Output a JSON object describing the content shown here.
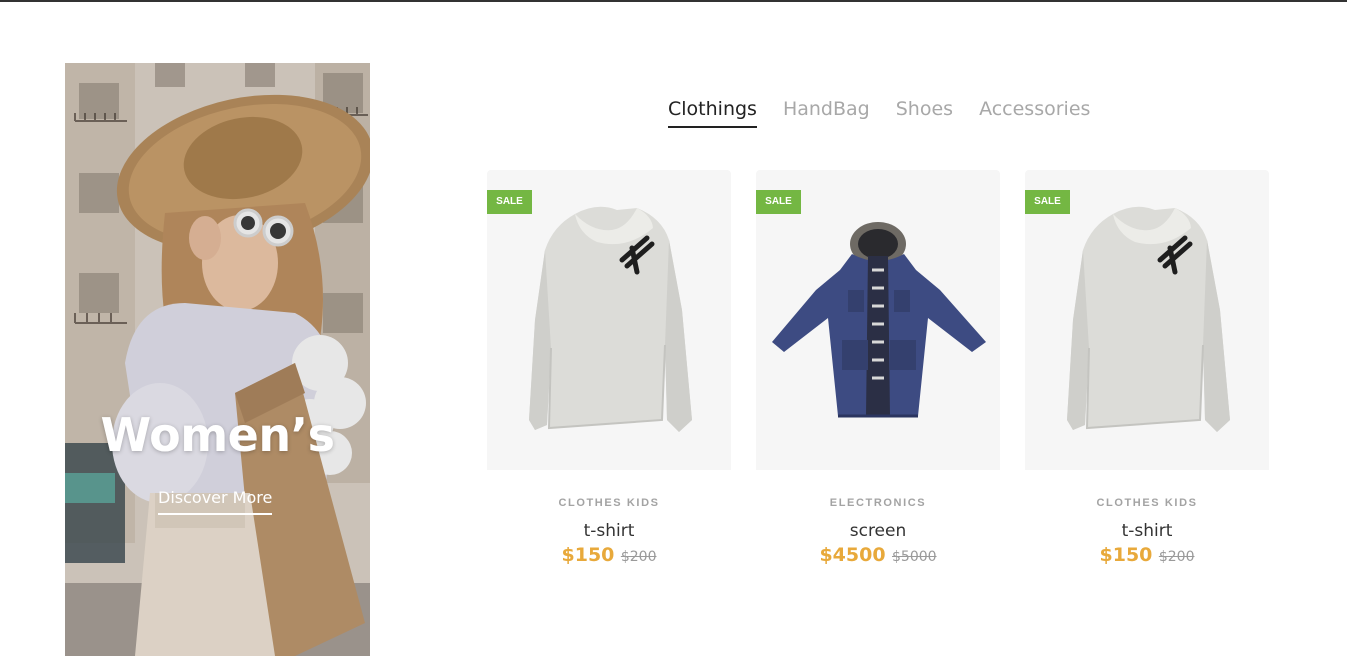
{
  "banner": {
    "title": "Women’s",
    "link_label": "Discover More"
  },
  "tabs": [
    {
      "label": "Clothings",
      "active": true
    },
    {
      "label": "HandBag",
      "active": false
    },
    {
      "label": "Shoes",
      "active": false
    },
    {
      "label": "Accessories",
      "active": false
    }
  ],
  "products": [
    {
      "badge": "SALE",
      "category": "CLOTHES KIDS",
      "name": "t-shirt",
      "price": "$150",
      "old_price": "$200",
      "image": "white-sweater-icon"
    },
    {
      "badge": "SALE",
      "category": "ELECTRONICS",
      "name": "screen",
      "price": "$4500",
      "old_price": "$5000",
      "image": "navy-parka-icon"
    },
    {
      "badge": "SALE",
      "category": "CLOTHES KIDS",
      "name": "t-shirt",
      "price": "$150",
      "old_price": "$200",
      "image": "white-sweater-icon"
    }
  ],
  "colors": {
    "sale_badge": "#74b743",
    "price": "#e8a93b",
    "tab_active": "#222222",
    "tab_inactive": "#a8a8a8"
  }
}
